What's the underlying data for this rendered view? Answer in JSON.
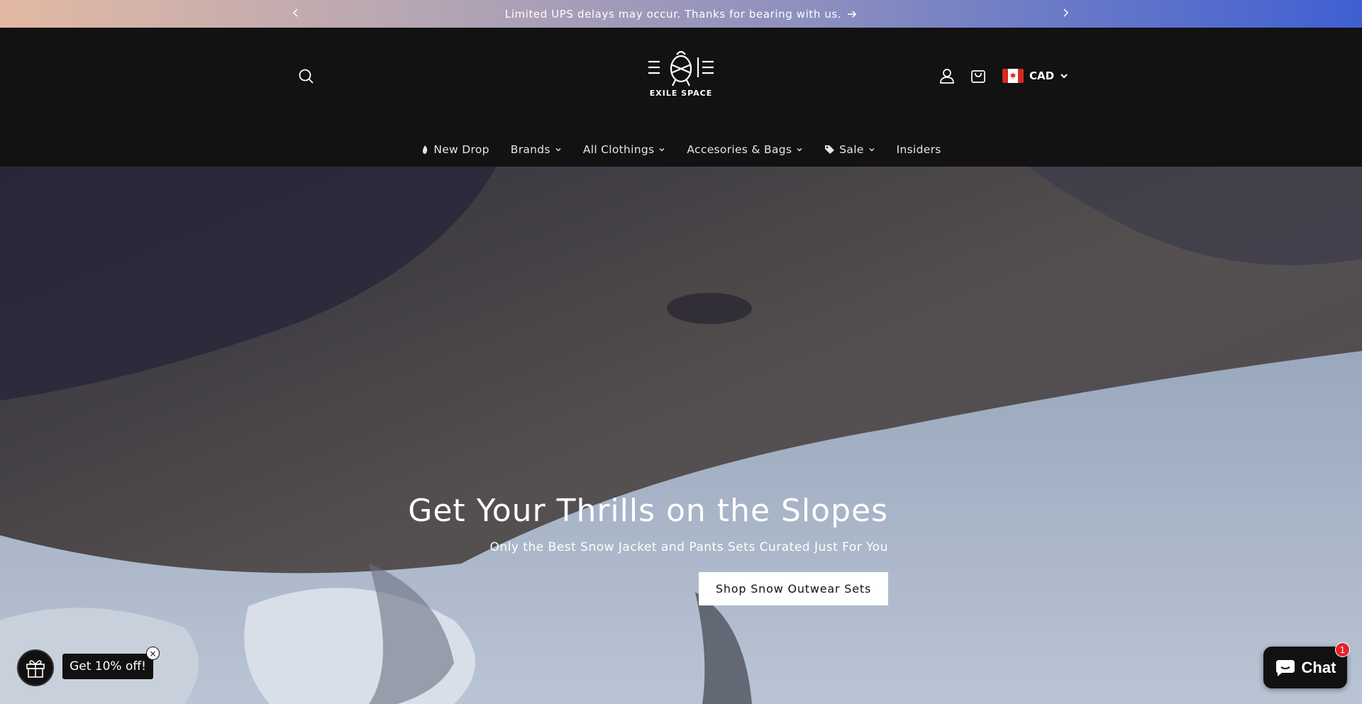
{
  "announcement": {
    "message": "Limited UPS delays may occur. Thanks for bearing with us.",
    "prev_icon": "chevron-left-icon",
    "next_icon": "chevron-right-icon",
    "arrow_icon": "arrow-right-icon"
  },
  "header": {
    "logo_text": "EXILE SPACE",
    "currency": {
      "code": "CAD",
      "flag": "canada-flag-icon"
    }
  },
  "nav": {
    "items": [
      {
        "label": "New Drop",
        "icon": "flame-icon",
        "has_dropdown": false
      },
      {
        "label": "Brands",
        "has_dropdown": true
      },
      {
        "label": "All Clothings",
        "has_dropdown": true
      },
      {
        "label": "Accesories & Bags",
        "has_dropdown": true
      },
      {
        "label": "Sale",
        "icon": "tag-icon",
        "has_dropdown": true
      },
      {
        "label": "Insiders",
        "has_dropdown": false
      }
    ]
  },
  "hero": {
    "title": "Get Your Thrills on the Slopes",
    "subtitle": "Only the Best Snow Jacket and Pants Sets Curated Just For You",
    "button_label": "Shop Snow Outwear Sets"
  },
  "discount": {
    "label": "Get 10% off!",
    "close": "×"
  },
  "chat": {
    "label": "Chat",
    "badge": "1"
  },
  "colors": {
    "header_bg": "#121212",
    "announce_start": "#e3b9a3",
    "announce_end": "#3f5fd2",
    "chat_badge": "#e0262d"
  }
}
